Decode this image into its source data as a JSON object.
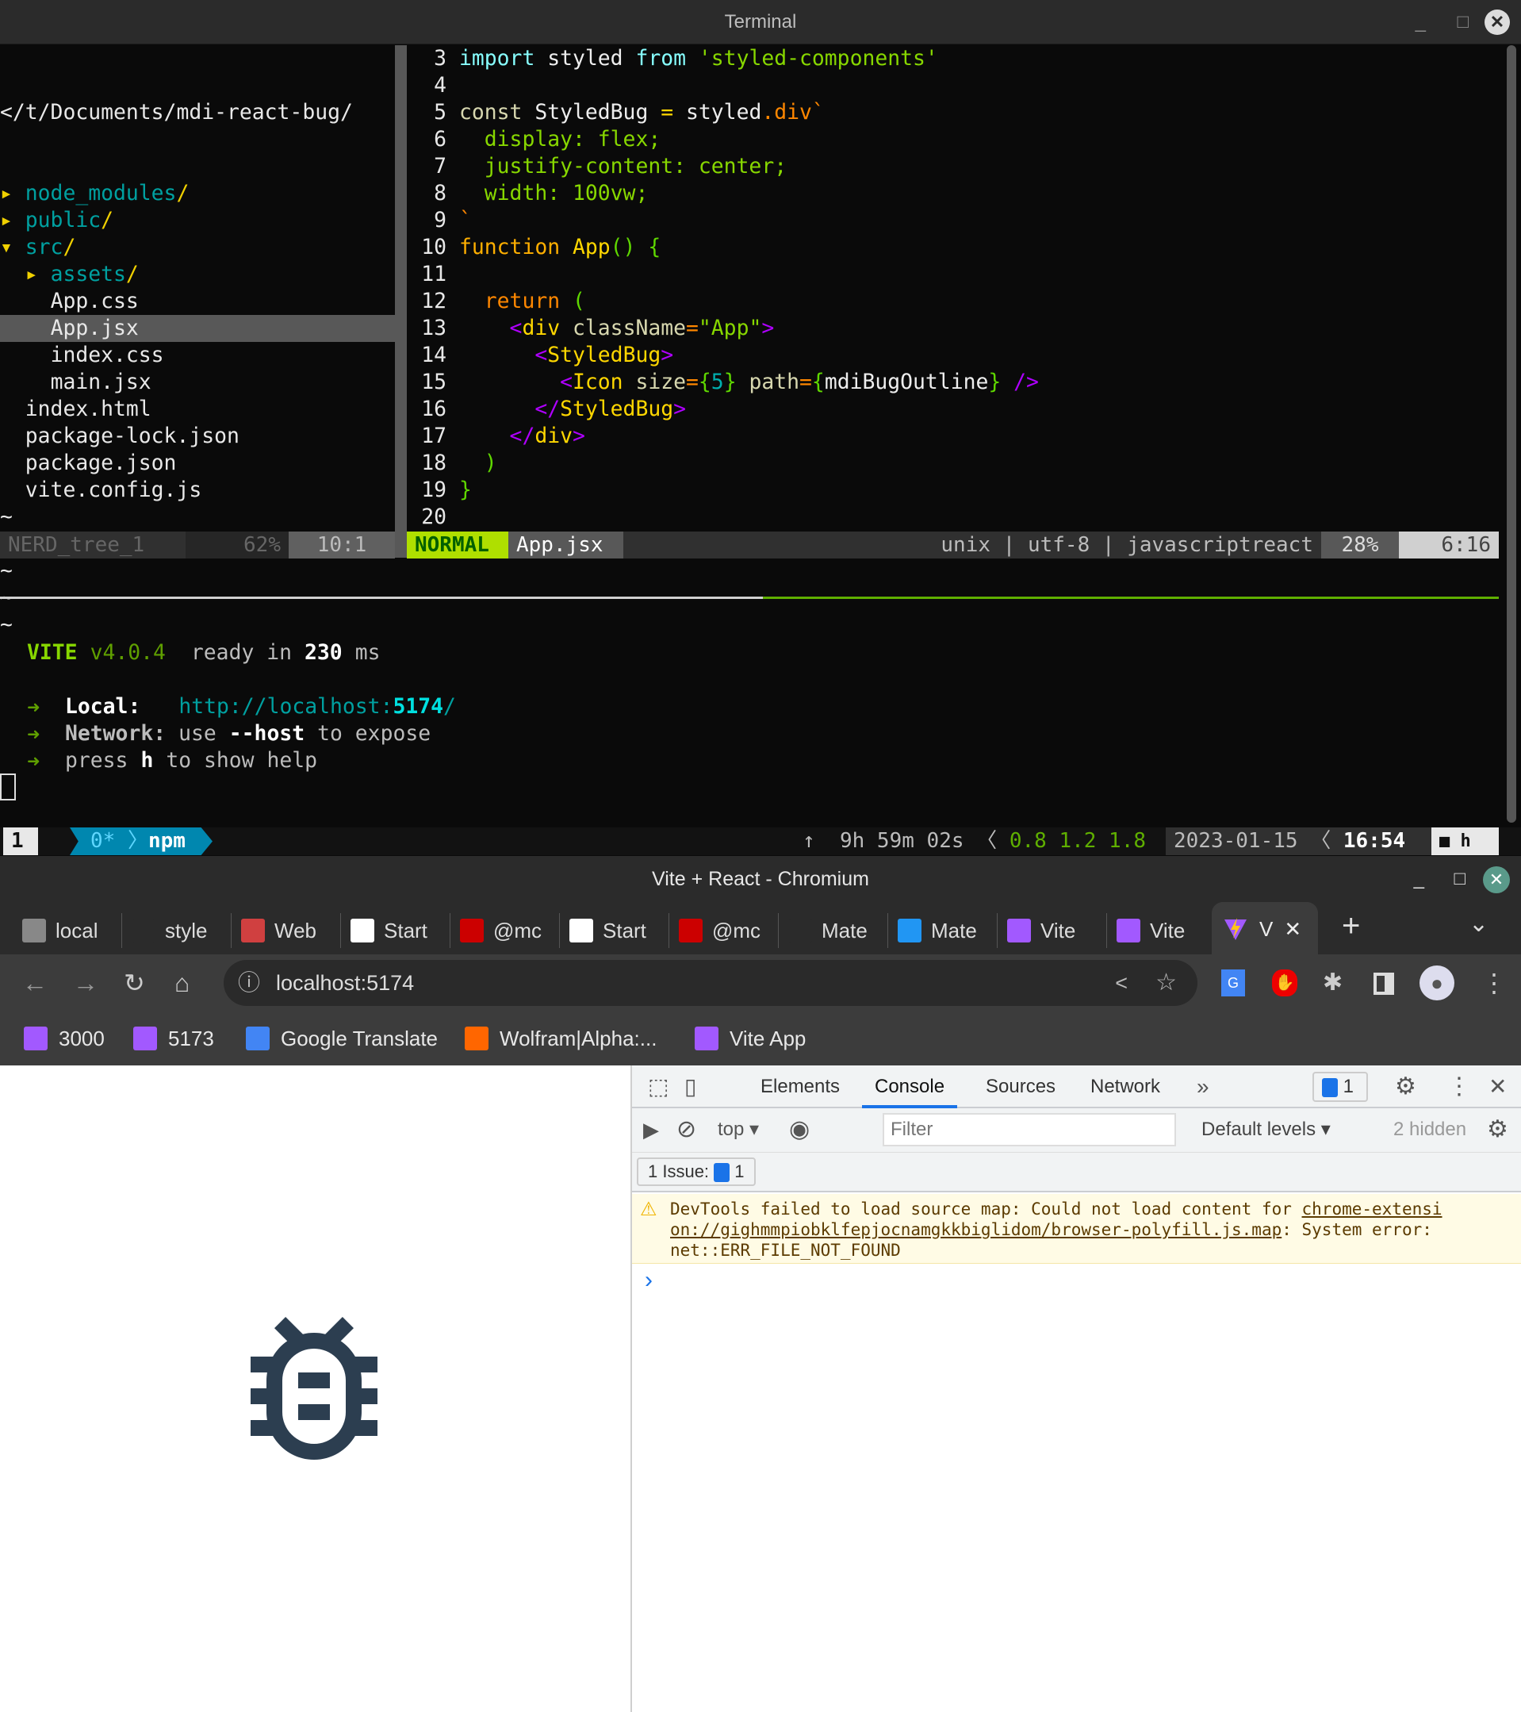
{
  "terminal": {
    "title": "Terminal",
    "nerdtree": {
      "root": "</t/Documents/mdi-react-bug/",
      "items": [
        {
          "indent": 0,
          "arrow": "▸",
          "name": "node_modules",
          "slash": "/",
          "type": "dir"
        },
        {
          "indent": 0,
          "arrow": "▸",
          "name": "public",
          "slash": "/",
          "type": "dir"
        },
        {
          "indent": 0,
          "arrow": "▾",
          "name": "src",
          "slash": "/",
          "type": "dir"
        },
        {
          "indent": 1,
          "arrow": "▸",
          "name": "assets",
          "slash": "/",
          "type": "dir"
        },
        {
          "indent": 1,
          "name": "App.css",
          "type": "file"
        },
        {
          "indent": 1,
          "name": "App.jsx",
          "type": "file",
          "selected": true
        },
        {
          "indent": 1,
          "name": "index.css",
          "type": "file"
        },
        {
          "indent": 1,
          "name": "main.jsx",
          "type": "file"
        },
        {
          "indent": 0,
          "name": "index.html",
          "type": "file"
        },
        {
          "indent": 0,
          "name": "package-lock.json",
          "type": "file"
        },
        {
          "indent": 0,
          "name": "package.json",
          "type": "file"
        },
        {
          "indent": 0,
          "name": "vite.config.js",
          "type": "file"
        }
      ],
      "tilde": "~",
      "status_name": "NERD_tree_1",
      "status_pct": "62%",
      "status_pos": "10:1"
    },
    "code_lines": [
      {
        "n": "3",
        "t": [
          [
            "import",
            "cyan"
          ],
          [
            " styled ",
            "white"
          ],
          [
            "from",
            "cyan"
          ],
          [
            " 'styled-components'",
            "green"
          ]
        ]
      },
      {
        "n": "4",
        "t": []
      },
      {
        "n": "5",
        "t": [
          [
            "const",
            "beige"
          ],
          [
            " StyledBug ",
            "white"
          ],
          [
            "=",
            "yellow"
          ],
          [
            " styled",
            "white"
          ],
          [
            ".div`",
            "orange"
          ]
        ]
      },
      {
        "n": "6",
        "t": [
          [
            "  display: flex;",
            "green"
          ]
        ]
      },
      {
        "n": "7",
        "t": [
          [
            "  justify-content: center;",
            "green"
          ]
        ]
      },
      {
        "n": "8",
        "t": [
          [
            "  width: 100vw;",
            "green"
          ]
        ]
      },
      {
        "n": "9",
        "t": [
          [
            "`",
            "orange"
          ]
        ]
      },
      {
        "n": "10",
        "t": [
          [
            "function",
            "fn"
          ],
          [
            " App",
            "yellow"
          ],
          [
            "()",
            "paren"
          ],
          [
            " {",
            "paren"
          ]
        ]
      },
      {
        "n": "11",
        "t": []
      },
      {
        "n": "12",
        "t": [
          [
            "  return",
            "orange"
          ],
          [
            " (",
            "paren"
          ]
        ]
      },
      {
        "n": "13",
        "t": [
          [
            "    <",
            "purple"
          ],
          [
            "div",
            "yellow"
          ],
          [
            " className",
            "beige"
          ],
          [
            "=",
            "orange"
          ],
          [
            "\"App\"",
            "green"
          ],
          [
            ">",
            "purple"
          ]
        ]
      },
      {
        "n": "14",
        "t": [
          [
            "      <",
            "purple"
          ],
          [
            "StyledBug",
            "yellow"
          ],
          [
            ">",
            "purple"
          ]
        ]
      },
      {
        "n": "15",
        "t": [
          [
            "        <",
            "purple"
          ],
          [
            "Icon",
            "yellow"
          ],
          [
            " size",
            "beige"
          ],
          [
            "=",
            "orange"
          ],
          [
            "{",
            "paren"
          ],
          [
            "5",
            "num"
          ],
          [
            "}",
            "paren"
          ],
          [
            " path",
            "beige"
          ],
          [
            "=",
            "orange"
          ],
          [
            "{",
            "paren"
          ],
          [
            "mdiBugOutline",
            "white"
          ],
          [
            "}",
            "paren"
          ],
          [
            " />",
            "purple"
          ]
        ]
      },
      {
        "n": "16",
        "t": [
          [
            "      </",
            "purple"
          ],
          [
            "StyledBug",
            "yellow"
          ],
          [
            ">",
            "purple"
          ]
        ]
      },
      {
        "n": "17",
        "t": [
          [
            "    </",
            "purple"
          ],
          [
            "div",
            "yellow"
          ],
          [
            ">",
            "purple"
          ]
        ]
      },
      {
        "n": "18",
        "t": [
          [
            "  )",
            "paren"
          ]
        ]
      },
      {
        "n": "19",
        "t": [
          [
            "}",
            "paren"
          ]
        ]
      },
      {
        "n": "20",
        "t": []
      }
    ],
    "vim_status": {
      "mode": "NORMAL",
      "file": "App.jsx",
      "info": "unix | utf-8 | javascriptreact",
      "pct": "28%",
      "pos": "6:16"
    },
    "vite": {
      "name": "VITE",
      "version": "v4.0.4",
      "ready": "ready in",
      "ms_value": "230",
      "ms": "ms",
      "arrow": "➜",
      "local_label": "Local:",
      "local_url_prefix": "http://localhost:",
      "local_port": "5174",
      "local_url_suffix": "/",
      "network_label": "Network:",
      "network_use": "use",
      "network_flag": "--host",
      "network_rest": "to expose",
      "press": "press",
      "key": "h",
      "help": "to show help"
    },
    "tmux": {
      "session": "1",
      "window": "0*",
      "name": "npm",
      "arrow_up": "↑",
      "uptime": "9h 59m 02s",
      "load": "0.8 1.2 1.8",
      "date": "2023-01-15",
      "time": "16:54",
      "lock": "🔒",
      "host": "h"
    }
  },
  "browser": {
    "title": "Vite + React - Chromium",
    "tabs": [
      {
        "label": "local",
        "color": "#888888"
      },
      {
        "label": "style",
        "color": "#2b2b2b"
      },
      {
        "label": "Web",
        "color": "#d04040"
      },
      {
        "label": "Start",
        "color": "#ffffff"
      },
      {
        "label": "@mc",
        "color": "#cc0000"
      },
      {
        "label": "Start",
        "color": "#ffffff"
      },
      {
        "label": "@mc",
        "color": "#cc0000"
      },
      {
        "label": "Mate",
        "color": "#2b2b2b"
      },
      {
        "label": "Mate",
        "color": "#2196f3"
      },
      {
        "label": "Vite",
        "color": "#a259ff"
      },
      {
        "label": "Vite",
        "color": "#a259ff"
      }
    ],
    "active_tab": {
      "label": "V",
      "close": "✕"
    },
    "new_tab": "+",
    "tab_menu": "⌄",
    "url": "localhost:5174",
    "bookmarks": [
      {
        "label": "3000",
        "icon": "vite-icon"
      },
      {
        "label": "5173",
        "icon": "vite-icon"
      },
      {
        "label": "Google Translate",
        "icon": "google-translate-icon"
      },
      {
        "label": "Wolfram|Alpha:...",
        "icon": "wolfram-icon"
      },
      {
        "label": "Vite App",
        "icon": "vite-icon"
      }
    ],
    "page_icon_color": "#2c3e50",
    "devtools": {
      "tabs": [
        "Elements",
        "Console",
        "Sources",
        "Network"
      ],
      "active_tab": "Console",
      "more": "»",
      "issues_badge": "1",
      "context": "top",
      "filter_placeholder": "Filter",
      "levels": "Default levels",
      "hidden": "2 hidden",
      "issues_label": "1 Issue:",
      "issues_count": "1",
      "warning": {
        "text": "DevTools failed to load source map: Could not load content for ",
        "link_line1": "chrome-extensi",
        "link_line2": "on://gighmmpiobklfepjocnamgkkbiglidom/browser-polyfill.js.map",
        "rest": ": System error:",
        "line3": "net::ERR_FILE_NOT_FOUND"
      },
      "prompt": "›"
    }
  }
}
